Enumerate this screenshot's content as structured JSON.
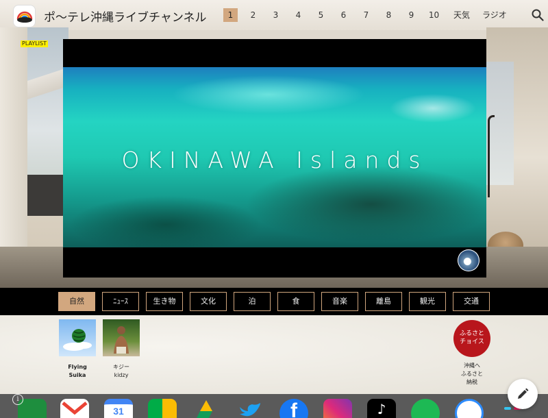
{
  "header": {
    "title": "ポ〜テレ沖縄ライブチャンネル",
    "nav": [
      "1",
      "2",
      "3",
      "4",
      "5",
      "6",
      "7",
      "8",
      "9",
      "10",
      "天気",
      "ラジオ"
    ],
    "active_nav": "1"
  },
  "playlist_badge": "PLAYLIST",
  "video": {
    "caption": "OKINAWA Islands"
  },
  "categories": [
    "自然",
    "ﾆｭｰｽ",
    "生き物",
    "文化",
    "泊",
    "食",
    "音楽",
    "離島",
    "観光",
    "交通"
  ],
  "active_category": "自然",
  "channels": [
    {
      "label_line1": "Flying",
      "label_line2": "Suika"
    },
    {
      "label_line1": "キジー",
      "label_line2": "kidzy"
    }
  ],
  "furusato": {
    "badge_line1": "ふるさと",
    "badge_line2": "チョイス",
    "label_line1": "沖縄へ",
    "label_line2": "ふるさと",
    "label_line3": "納税"
  },
  "dock_apps": [
    "sheets-icon",
    "gmail-icon",
    "calendar-icon",
    "meet-icon",
    "drive-icon",
    "twitter-icon",
    "facebook-icon",
    "instagram-icon",
    "tiktok-icon",
    "spotify-icon",
    "zoom-icon",
    "slack-icon"
  ],
  "colors": {
    "accent": "#d2a77f",
    "badge_yellow": "#ffef00",
    "furusato_red": "#b8161c"
  }
}
